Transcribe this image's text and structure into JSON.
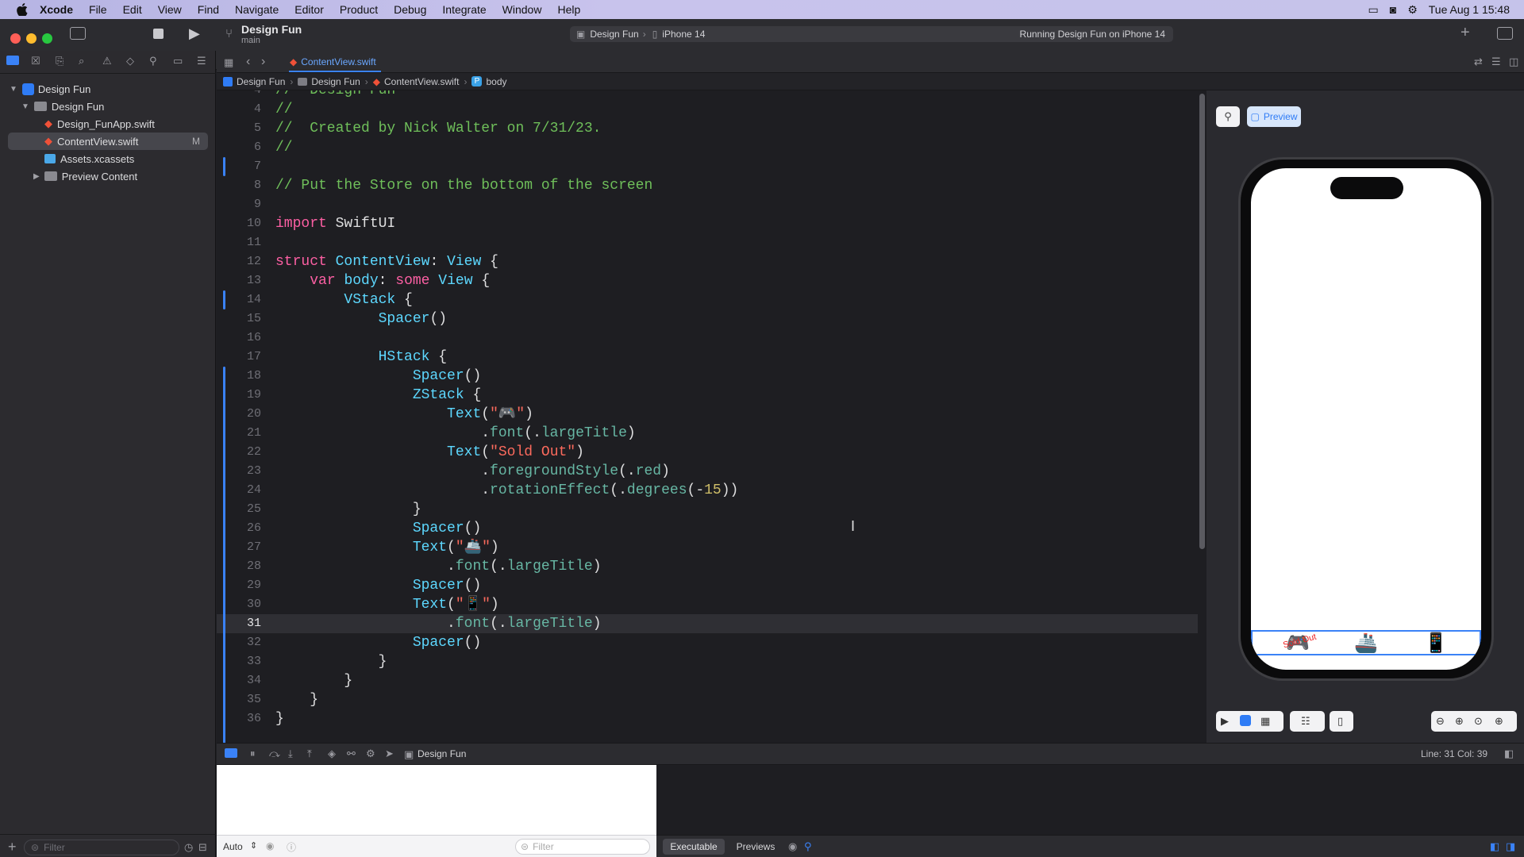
{
  "menubar": {
    "app": "Xcode",
    "items": [
      "File",
      "Edit",
      "View",
      "Find",
      "Navigate",
      "Editor",
      "Product",
      "Debug",
      "Integrate",
      "Window",
      "Help"
    ],
    "clock": "Tue Aug 1  15:48"
  },
  "toolbar": {
    "project": "Design Fun",
    "branch": "main",
    "scheme": "Design Fun",
    "device": "iPhone 14",
    "status": "Running Design Fun on iPhone 14"
  },
  "tab": {
    "filename": "ContentView.swift"
  },
  "breadcrumb": [
    "Design Fun",
    "Design Fun",
    "ContentView.swift",
    "body"
  ],
  "navigator": {
    "items": [
      {
        "label": "Design Fun",
        "level": 0,
        "kind": "project",
        "expanded": true
      },
      {
        "label": "Design Fun",
        "level": 1,
        "kind": "folder",
        "expanded": true
      },
      {
        "label": "Design_FunApp.swift",
        "level": 2,
        "kind": "swift"
      },
      {
        "label": "ContentView.swift",
        "level": 2,
        "kind": "swift",
        "selected": true,
        "badge": "M"
      },
      {
        "label": "Assets.xcassets",
        "level": 2,
        "kind": "assets"
      },
      {
        "label": "Preview Content",
        "level": 2,
        "kind": "folder",
        "expanded": false
      }
    ],
    "filter_placeholder": "Filter"
  },
  "code": [
    {
      "n": "4",
      "t": [
        [
          "cm",
          "//  Design Fun"
        ]
      ]
    },
    {
      "n": "4",
      "t": [
        [
          "cm",
          "//"
        ]
      ]
    },
    {
      "n": "5",
      "t": [
        [
          "cm",
          "//  Created by Nick Walter on 7/31/23."
        ]
      ]
    },
    {
      "n": "6",
      "t": [
        [
          "cm",
          "//"
        ]
      ]
    },
    {
      "n": "7",
      "t": []
    },
    {
      "n": "8",
      "t": [
        [
          "cm",
          "// Put the Store on the bottom of the screen"
        ]
      ]
    },
    {
      "n": "9",
      "t": []
    },
    {
      "n": "10",
      "t": [
        [
          "kw",
          "import"
        ],
        [
          "pl",
          " SwiftUI"
        ]
      ]
    },
    {
      "n": "11",
      "t": []
    },
    {
      "n": "12",
      "t": [
        [
          "kw",
          "struct"
        ],
        [
          "pl",
          " "
        ],
        [
          "ty",
          "ContentView"
        ],
        [
          "pl",
          ": "
        ],
        [
          "ty",
          "View"
        ],
        [
          "pl",
          " {"
        ]
      ]
    },
    {
      "n": "13",
      "t": [
        [
          "pl",
          "    "
        ],
        [
          "kw",
          "var"
        ],
        [
          "pl",
          " "
        ],
        [
          "ty",
          "body"
        ],
        [
          "pl",
          ": "
        ],
        [
          "kw",
          "some"
        ],
        [
          "pl",
          " "
        ],
        [
          "ty",
          "View"
        ],
        [
          "pl",
          " {"
        ]
      ]
    },
    {
      "n": "14",
      "t": [
        [
          "pl",
          "        "
        ],
        [
          "ty",
          "VStack"
        ],
        [
          "pl",
          " {"
        ]
      ]
    },
    {
      "n": "15",
      "t": [
        [
          "pl",
          "            "
        ],
        [
          "ty",
          "Spacer"
        ],
        [
          "pl",
          "()"
        ]
      ]
    },
    {
      "n": "16",
      "t": []
    },
    {
      "n": "17",
      "t": [
        [
          "pl",
          "            "
        ],
        [
          "ty",
          "HStack"
        ],
        [
          "pl",
          " {"
        ]
      ]
    },
    {
      "n": "18",
      "t": [
        [
          "pl",
          "                "
        ],
        [
          "ty",
          "Spacer"
        ],
        [
          "pl",
          "()"
        ]
      ]
    },
    {
      "n": "19",
      "t": [
        [
          "pl",
          "                "
        ],
        [
          "ty",
          "ZStack"
        ],
        [
          "pl",
          " {"
        ]
      ]
    },
    {
      "n": "20",
      "t": [
        [
          "pl",
          "                    "
        ],
        [
          "ty",
          "Text"
        ],
        [
          "pl",
          "("
        ],
        [
          "str",
          "\"🎮\""
        ],
        [
          "pl",
          ")"
        ]
      ]
    },
    {
      "n": "21",
      "t": [
        [
          "pl",
          "                        ."
        ],
        [
          "mem",
          "font"
        ],
        [
          "pl",
          "(."
        ],
        [
          "mem",
          "largeTitle"
        ],
        [
          "pl",
          ")"
        ]
      ]
    },
    {
      "n": "22",
      "t": [
        [
          "pl",
          "                    "
        ],
        [
          "ty",
          "Text"
        ],
        [
          "pl",
          "("
        ],
        [
          "str",
          "\"Sold Out\""
        ],
        [
          "pl",
          ")"
        ]
      ]
    },
    {
      "n": "23",
      "t": [
        [
          "pl",
          "                        ."
        ],
        [
          "mem",
          "foregroundStyle"
        ],
        [
          "pl",
          "(."
        ],
        [
          "mem",
          "red"
        ],
        [
          "pl",
          ")"
        ]
      ]
    },
    {
      "n": "24",
      "t": [
        [
          "pl",
          "                        ."
        ],
        [
          "mem",
          "rotationEffect"
        ],
        [
          "pl",
          "(."
        ],
        [
          "mem",
          "degrees"
        ],
        [
          "pl",
          "(-"
        ],
        [
          "num",
          "15"
        ],
        [
          "pl",
          "))"
        ]
      ]
    },
    {
      "n": "25",
      "t": [
        [
          "pl",
          "                }"
        ]
      ]
    },
    {
      "n": "26",
      "t": [
        [
          "pl",
          "                "
        ],
        [
          "ty",
          "Spacer"
        ],
        [
          "pl",
          "()"
        ]
      ]
    },
    {
      "n": "27",
      "t": [
        [
          "pl",
          "                "
        ],
        [
          "ty",
          "Text"
        ],
        [
          "pl",
          "("
        ],
        [
          "str",
          "\"🚢\""
        ],
        [
          "pl",
          ")"
        ]
      ]
    },
    {
      "n": "28",
      "t": [
        [
          "pl",
          "                    ."
        ],
        [
          "mem",
          "font"
        ],
        [
          "pl",
          "(."
        ],
        [
          "mem",
          "largeTitle"
        ],
        [
          "pl",
          ")"
        ]
      ]
    },
    {
      "n": "29",
      "t": [
        [
          "pl",
          "                "
        ],
        [
          "ty",
          "Spacer"
        ],
        [
          "pl",
          "()"
        ]
      ]
    },
    {
      "n": "30",
      "t": [
        [
          "pl",
          "                "
        ],
        [
          "ty",
          "Text"
        ],
        [
          "pl",
          "("
        ],
        [
          "str",
          "\"📱\""
        ],
        [
          "pl",
          ")"
        ]
      ]
    },
    {
      "n": "31",
      "t": [
        [
          "pl",
          "                    ."
        ],
        [
          "mem",
          "font"
        ],
        [
          "pl",
          "(."
        ],
        [
          "mem",
          "largeTitle"
        ],
        [
          "pl",
          ")"
        ]
      ],
      "current": true
    },
    {
      "n": "32",
      "t": [
        [
          "pl",
          "                "
        ],
        [
          "ty",
          "Spacer"
        ],
        [
          "pl",
          "()"
        ]
      ]
    },
    {
      "n": "33",
      "t": [
        [
          "pl",
          "            }"
        ]
      ]
    },
    {
      "n": "34",
      "t": [
        [
          "pl",
          "        }"
        ]
      ]
    },
    {
      "n": "35",
      "t": [
        [
          "pl",
          "    }"
        ]
      ]
    },
    {
      "n": "36",
      "t": [
        [
          "pl",
          "}"
        ]
      ]
    }
  ],
  "preview": {
    "button_label": "Preview",
    "sold_out": "Sold Out",
    "emojis": [
      "🎮",
      "🚢",
      "📱"
    ]
  },
  "status": {
    "position": "Line: 31  Col: 39"
  },
  "debug": {
    "target": "Design Fun",
    "scope": "Auto",
    "filter_placeholder": "Filter",
    "tabs": [
      "Executable",
      "Previews"
    ],
    "selected_tab": "Executable"
  },
  "colors": {
    "comment": "#6fbf5a",
    "keyword": "#fc5fa3",
    "type": "#5dd8ff",
    "string": "#fc6a5d",
    "accent": "#3a82f7"
  }
}
